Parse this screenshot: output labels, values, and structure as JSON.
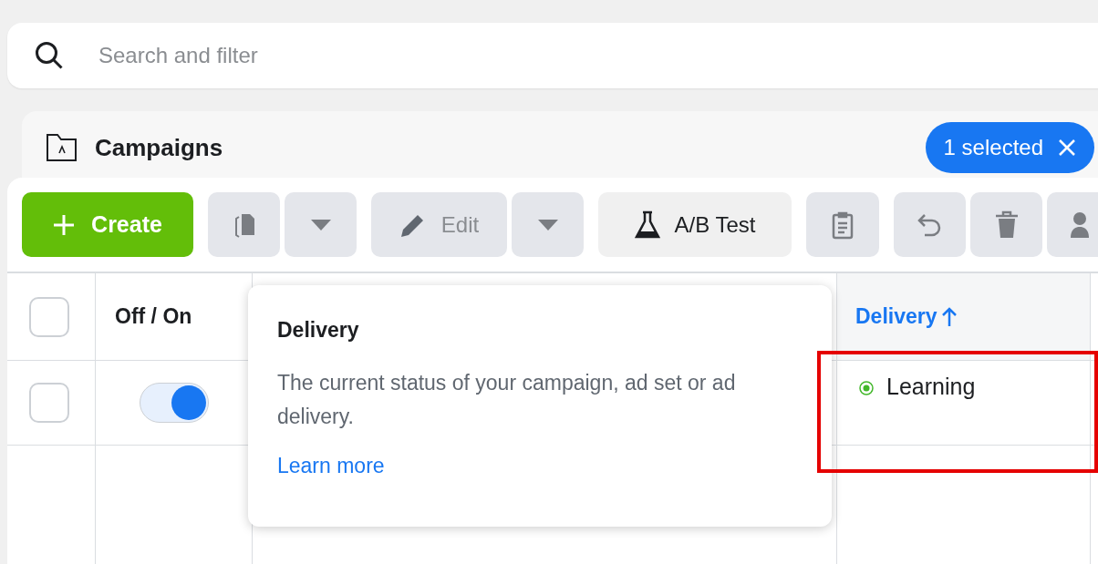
{
  "search": {
    "placeholder": "Search and filter"
  },
  "panel": {
    "title": "Campaigns",
    "selection": "1 selected"
  },
  "toolbar": {
    "create": "Create",
    "edit": {
      "label": "Edit",
      "disabled": true
    },
    "ab_test": "A/B Test"
  },
  "table": {
    "header_checked": false,
    "columns": [
      {
        "label": "Off / On",
        "sorted": false
      },
      {
        "label": "Delivery",
        "sorted": true
      }
    ],
    "rows": [
      {
        "checked": false,
        "on": true,
        "delivery": "Learning"
      }
    ]
  },
  "tooltip": {
    "title": "Delivery",
    "text": "The current status of your campaign, ad set or ad delivery.",
    "link": "Learn more"
  }
}
